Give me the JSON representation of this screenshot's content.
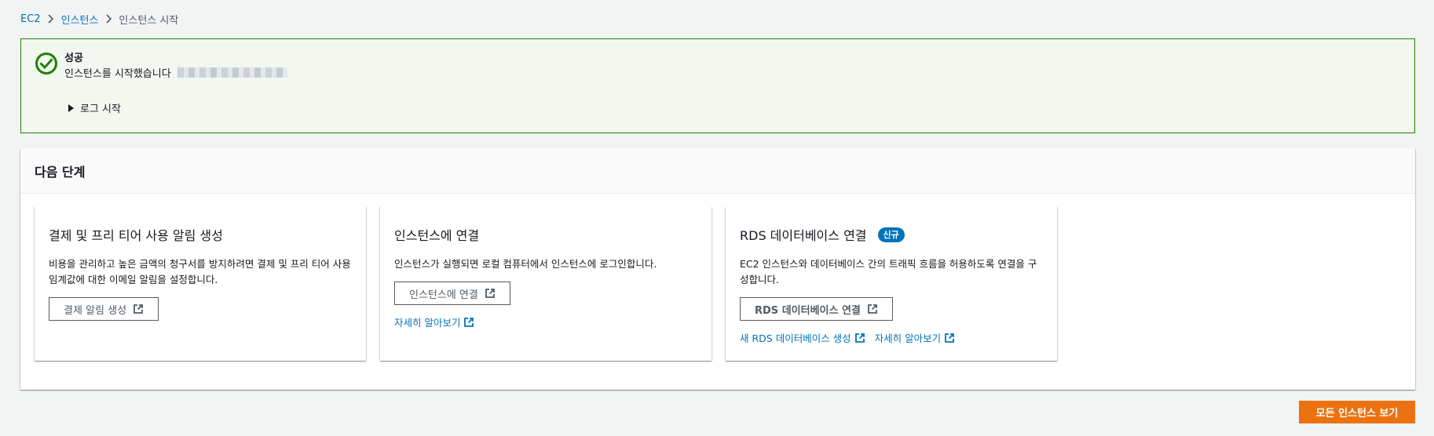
{
  "breadcrumb": {
    "items": [
      "EC2",
      "인스턴스"
    ],
    "current": "인스턴스 시작"
  },
  "flash": {
    "title": "성공",
    "message": "인스턴스를 시작했습니다",
    "toggle_label": "로그 시작",
    "color": "#1d8102"
  },
  "next_steps": {
    "title": "다음 단계",
    "cards": [
      {
        "title": "결제 및 프리 티어 사용 알림 생성",
        "description": "비용을 관리하고 높은 금액의 청구서를 방지하려면 결제 및 프리 티어 사용 임계값에 대한 이메일 알림을 설정합니다.",
        "button_label": "결제 알림 생성"
      },
      {
        "title": "인스턴스에 연결",
        "description": "인스턴스가 실행되면 로컬 컴퓨터에서 인스턴스에 로그인합니다.",
        "button_label": "인스턴스에 연결",
        "link_learn_more": "자세히 알아보기"
      },
      {
        "title": "RDS 데이터베이스 연결",
        "badge": "신규",
        "description": "EC2 인스턴스와 데이터베이스 간의 트래픽 흐름을 허용하도록 연결을 구성합니다.",
        "button_label": "RDS 데이터베이스 연결",
        "link_create": "새 RDS 데이터베이스 생성",
        "link_learn_more": "자세히 알아보기"
      }
    ]
  },
  "footer": {
    "view_all_label": "모든 인스턴스 보기"
  },
  "colors": {
    "link": "#0073bb",
    "primary": "#ec7211",
    "badge": "#0073bb"
  }
}
